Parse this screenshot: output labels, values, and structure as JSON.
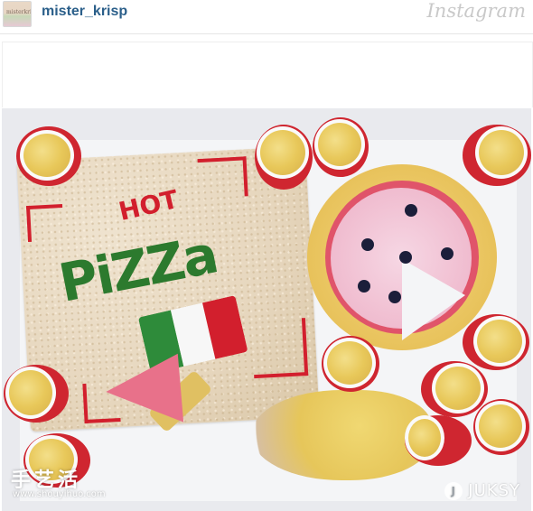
{
  "header": {
    "avatar_text": "misterkrisp",
    "username": "mister_krisp",
    "brand_logo": "Instagram"
  },
  "photo": {
    "sign_hot": "HOT",
    "sign_pizza": "PiZZa",
    "flag_colors": [
      "#2e8b3a",
      "#f7f7f7",
      "#d21f2d"
    ]
  },
  "watermarks": {
    "site_chinese": "手艺活",
    "site_url": "www.shouyihuo.com",
    "juksy_label": "JUKSY",
    "juksy_icon": "juksy-logo-icon"
  }
}
